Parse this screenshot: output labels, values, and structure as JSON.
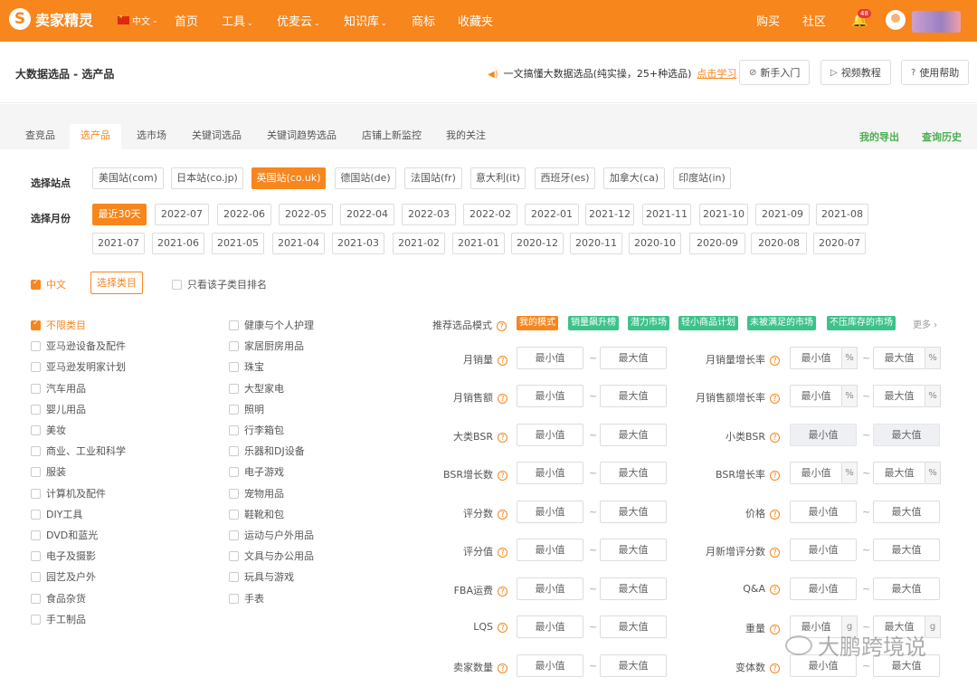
{
  "nav": {
    "logo": "卖家精灵",
    "lang": "中文",
    "items": [
      "首页",
      "工具",
      "优麦云",
      "知识库",
      "商标",
      "收藏夹"
    ],
    "right": [
      "购买",
      "社区"
    ],
    "badge": "48"
  },
  "header": {
    "title": "大数据选品 - 选产品",
    "notice": "一文搞懂大数据选品(纯实操，25+种选品)",
    "notice_link": "点击学习",
    "buttons": [
      "新手入门",
      "视频教程",
      "使用帮助"
    ]
  },
  "tabs": [
    "查竞品",
    "选产品",
    "选市场",
    "关键词选品",
    "关键词趋势选品",
    "店铺上新监控",
    "我的关注"
  ],
  "tabs_right": [
    "我的导出",
    "查询历史"
  ],
  "site": {
    "label": "选择站点",
    "options": [
      "美国站(com)",
      "日本站(co.jp)",
      "英国站(co.uk)",
      "德国站(de)",
      "法国站(fr)",
      "意大利(it)",
      "西班牙(es)",
      "加拿大(ca)",
      "印度站(in)"
    ],
    "selected": "英国站(co.uk)"
  },
  "month": {
    "label": "选择月份",
    "row1": [
      "最近30天",
      "2022-07",
      "2022-06",
      "2022-05",
      "2022-04",
      "2022-03",
      "2022-02",
      "2022-01",
      "2021-12",
      "2021-11",
      "2021-10",
      "2021-09",
      "2021-08"
    ],
    "row2": [
      "2021-07",
      "2021-06",
      "2021-05",
      "2021-04",
      "2021-03",
      "2021-02",
      "2021-01",
      "2020-12",
      "2020-11",
      "2020-10",
      "2020-09",
      "2020-08",
      "2020-07"
    ],
    "selected": "最近30天"
  },
  "category_controls": {
    "lang_checkbox": "中文",
    "select_button": "选择类目",
    "subcat_checkbox": "只看该子类目排名"
  },
  "categories_left": [
    "不限类目",
    "亚马逊设备及配件",
    "亚马逊发明家计划",
    "汽车用品",
    "婴儿用品",
    "美妆",
    "商业、工业和科学",
    "服装",
    "计算机及配件",
    "DIY工具",
    "DVD和蓝光",
    "电子及摄影",
    "园艺及户外",
    "食品杂货",
    "手工制品"
  ],
  "categories_right": [
    "健康与个人护理",
    "家居厨房用品",
    "珠宝",
    "大型家电",
    "照明",
    "行李箱包",
    "乐器和DJ设备",
    "电子游戏",
    "宠物用品",
    "鞋靴和包",
    "运动与户外用品",
    "文具与办公用品",
    "玩具与游戏",
    "手表"
  ],
  "mode": {
    "label": "推荐选品模式",
    "tags": [
      "我的模式",
      "销量飙升榜",
      "潜力市场",
      "轻小商品计划",
      "未被满足的市场",
      "不压库存的市场"
    ],
    "more": "更多"
  },
  "fields": {
    "min": "最小值",
    "max": "最大值",
    "percent": "%",
    "tilde": "~",
    "left": [
      "月销量",
      "月销售额",
      "大类BSR",
      "BSR增长数",
      "评分数",
      "评分值",
      "FBA运费",
      "LQS",
      "卖家数量"
    ],
    "right": [
      "月销量增长率",
      "月销售额增长率",
      "小类BSR",
      "BSR增长率",
      "价格",
      "月新增评分数",
      "Q&A",
      "重量",
      "变体数"
    ],
    "weight_unit": "g"
  },
  "watermark": "大鹏跨境说",
  "colors": {
    "brand": "#f7861d",
    "tag_green": "#3cc28a",
    "link_green": "#4caf50"
  }
}
